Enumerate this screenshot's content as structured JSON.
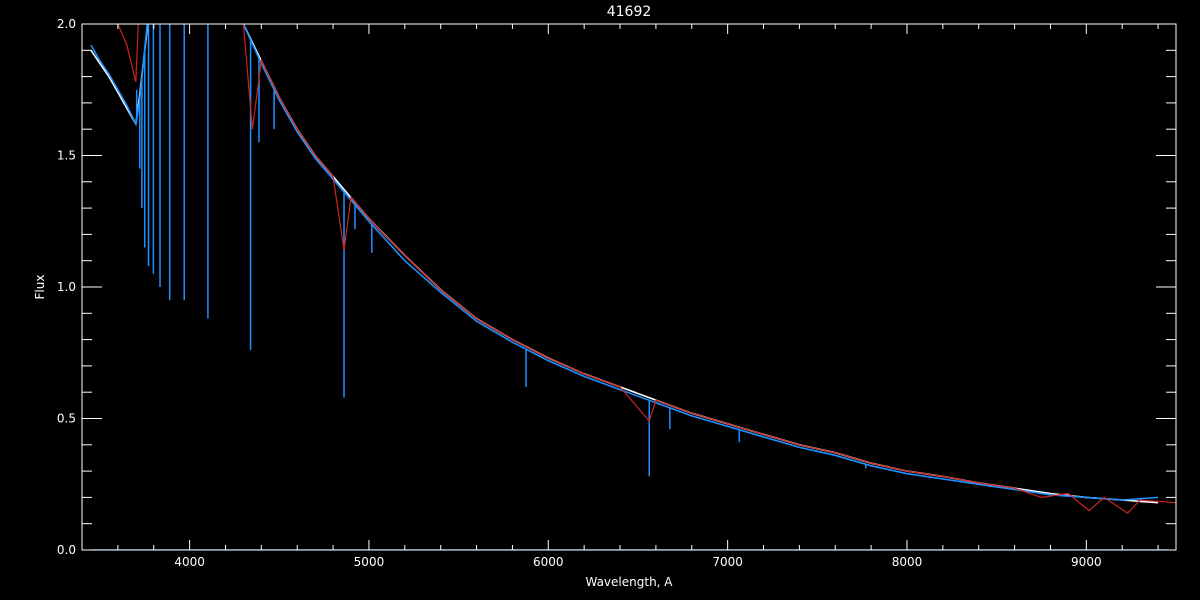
{
  "chart_data": {
    "type": "line",
    "title": "41692",
    "xlabel": "Wavelength, A",
    "ylabel": "Flux",
    "xlim": [
      3400,
      9500
    ],
    "ylim": [
      0,
      2.0
    ],
    "x_ticks": [
      4000,
      5000,
      6000,
      7000,
      8000,
      9000
    ],
    "x_tick_labels": [
      "4000",
      "5000",
      "6000",
      "7000",
      "8000",
      "9000"
    ],
    "y_ticks": [
      0.0,
      0.5,
      1.0,
      1.5,
      2.0
    ],
    "y_tick_labels": [
      "0.0",
      "0.5",
      "1.0",
      "1.5",
      "2.0"
    ],
    "grid": false,
    "background": "#000000",
    "axis_color": "#ffffff",
    "series": [
      {
        "color": "#ffffff",
        "style": "observed",
        "x": [
          3450,
          3500,
          3550,
          3600,
          3650,
          3700,
          3720,
          3800,
          3900,
          4000,
          4100,
          4200,
          4300,
          4400,
          4500,
          4600,
          4700,
          4800,
          4850,
          4900,
          5000,
          5200,
          5400,
          5600,
          5800,
          6000,
          6200,
          6400,
          6600,
          6800,
          7000,
          7200,
          7400,
          7600,
          7800,
          8000,
          8200,
          8400,
          8600,
          8800,
          9000,
          9200,
          9400
        ],
        "y": [
          1.9,
          1.85,
          1.8,
          1.74,
          1.68,
          1.62,
          1.72,
          2.2,
          2.5,
          2.45,
          2.3,
          2.15,
          2.0,
          1.86,
          1.72,
          1.6,
          1.5,
          1.42,
          1.38,
          1.34,
          1.26,
          1.12,
          0.99,
          0.88,
          0.8,
          0.73,
          0.67,
          0.62,
          0.57,
          0.52,
          0.48,
          0.44,
          0.4,
          0.37,
          0.33,
          0.3,
          0.28,
          0.255,
          0.235,
          0.215,
          0.2,
          0.19,
          0.18
        ]
      },
      {
        "color": "#1e90ff",
        "style": "observed-lines",
        "x": [
          3450,
          3500,
          3550,
          3600,
          3650,
          3700,
          3720,
          3800,
          3900,
          4000,
          4100,
          4200,
          4300,
          4400,
          4500,
          4600,
          4700,
          4800,
          4850,
          4900,
          5000,
          5200,
          5400,
          5600,
          5800,
          6000,
          6200,
          6400,
          6600,
          6800,
          7000,
          7200,
          7400,
          7600,
          7800,
          8000,
          8200,
          8400,
          8600,
          8800,
          9000,
          9200,
          9400
        ],
        "y": [
          1.92,
          1.86,
          1.81,
          1.75,
          1.69,
          1.62,
          1.7,
          2.25,
          2.5,
          2.45,
          2.3,
          2.15,
          2.0,
          1.85,
          1.71,
          1.59,
          1.49,
          1.41,
          1.37,
          1.33,
          1.25,
          1.1,
          0.98,
          0.87,
          0.79,
          0.72,
          0.66,
          0.61,
          0.56,
          0.51,
          0.47,
          0.43,
          0.39,
          0.36,
          0.32,
          0.29,
          0.27,
          0.25,
          0.23,
          0.21,
          0.2,
          0.19,
          0.2
        ],
        "absorption_lines": [
          {
            "x": 3705,
            "y": 1.75
          },
          {
            "x": 3722,
            "y": 1.45
          },
          {
            "x": 3734,
            "y": 1.3
          },
          {
            "x": 3750,
            "y": 1.15
          },
          {
            "x": 3771,
            "y": 1.08
          },
          {
            "x": 3798,
            "y": 1.05
          },
          {
            "x": 3835,
            "y": 1.0
          },
          {
            "x": 3889,
            "y": 0.95
          },
          {
            "x": 3970,
            "y": 0.95
          },
          {
            "x": 4102,
            "y": 0.88
          },
          {
            "x": 4340,
            "y": 0.76
          },
          {
            "x": 4387,
            "y": 1.55
          },
          {
            "x": 4471,
            "y": 1.6
          },
          {
            "x": 4861,
            "y": 0.58
          },
          {
            "x": 4922,
            "y": 1.22
          },
          {
            "x": 5016,
            "y": 1.13
          },
          {
            "x": 5876,
            "y": 0.62
          },
          {
            "x": 6563,
            "y": 0.28
          },
          {
            "x": 6678,
            "y": 0.46
          },
          {
            "x": 7065,
            "y": 0.41
          },
          {
            "x": 7770,
            "y": 0.31
          }
        ]
      },
      {
        "color": "#cc2222",
        "style": "model",
        "x": [
          3600,
          3650,
          3700,
          3720,
          3800,
          3900,
          4000,
          4100,
          4200,
          4300,
          4350,
          4400,
          4500,
          4600,
          4700,
          4800,
          4861,
          4900,
          5000,
          5200,
          5400,
          5600,
          5800,
          6000,
          6200,
          6400,
          6563,
          6600,
          6800,
          7000,
          7200,
          7400,
          7600,
          7800,
          8000,
          8200,
          8400,
          8600,
          8750,
          8900,
          9015,
          9100,
          9230,
          9300,
          9500
        ],
        "y": [
          2.0,
          1.92,
          1.78,
          2.1,
          2.5,
          2.5,
          2.45,
          2.3,
          2.15,
          2.0,
          1.6,
          1.86,
          1.72,
          1.6,
          1.5,
          1.42,
          1.14,
          1.34,
          1.26,
          1.12,
          0.99,
          0.88,
          0.8,
          0.73,
          0.67,
          0.62,
          0.49,
          0.57,
          0.52,
          0.48,
          0.44,
          0.4,
          0.37,
          0.33,
          0.3,
          0.28,
          0.255,
          0.235,
          0.2,
          0.215,
          0.15,
          0.2,
          0.14,
          0.19,
          0.18
        ]
      },
      {
        "color": "#1e90ff",
        "style": "baseline",
        "x": [
          3450,
          9450
        ],
        "y": [
          0.0,
          0.0
        ]
      }
    ]
  }
}
